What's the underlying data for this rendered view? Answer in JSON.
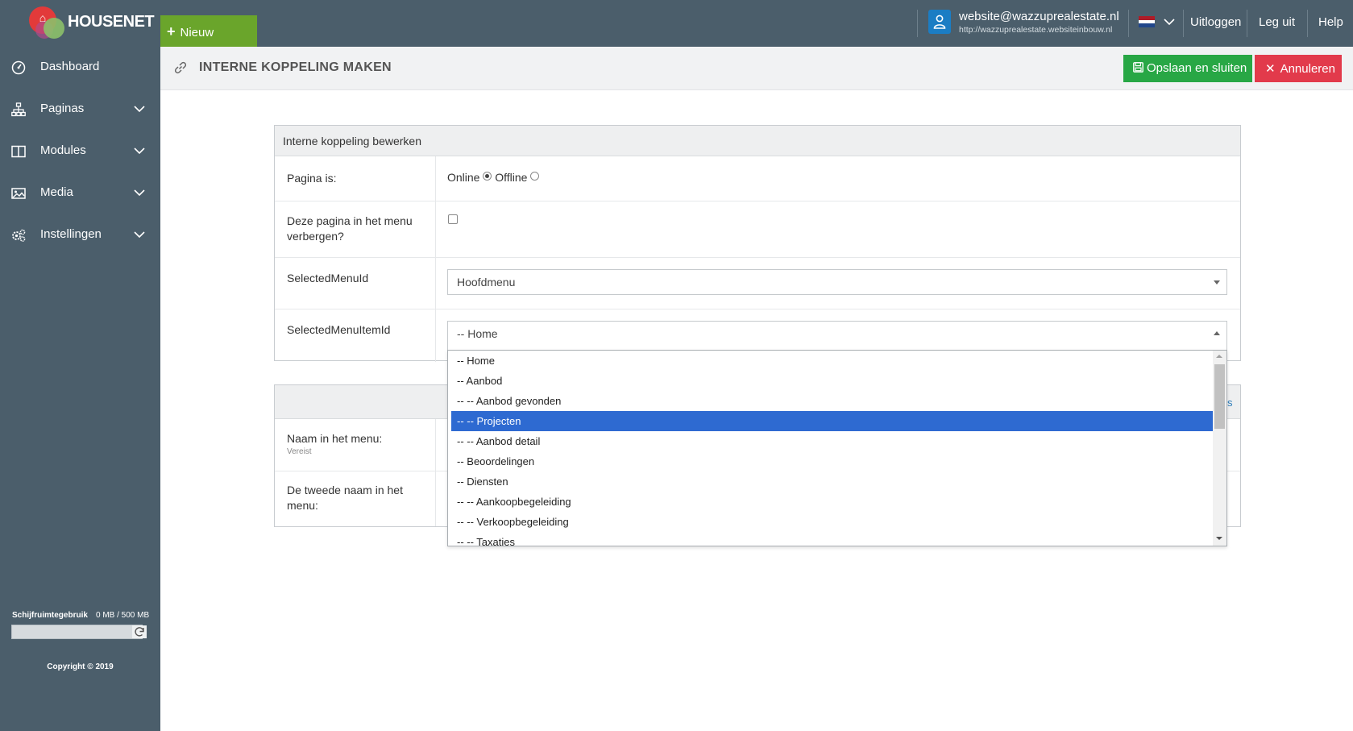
{
  "brand": {
    "name": "HOUSENET"
  },
  "topbar": {
    "new_label": "Nieuw",
    "user_email": "website@wazzuprealestate.nl",
    "user_url": "http://wazzuprealestate.websiteinbouw.nl",
    "logout_label": "Uitloggen",
    "logout2_label": "Leg uit",
    "help_label": "Help"
  },
  "sidebar": {
    "items": [
      {
        "label": "Dashboard",
        "icon": "dashboard-icon"
      },
      {
        "label": "Paginas",
        "icon": "sitemap-icon"
      },
      {
        "label": "Modules",
        "icon": "columns-icon"
      },
      {
        "label": "Media",
        "icon": "image-icon"
      },
      {
        "label": "Instellingen",
        "icon": "cogs-icon"
      }
    ],
    "disk_label": "Schijfruimtegebruik",
    "disk_value": "0 MB / 500 MB",
    "copyright": "Copyright © 2019"
  },
  "header": {
    "title": "INTERNE KOPPELING MAKEN",
    "save_label": "Opslaan en sluiten",
    "cancel_label": "Annuleren"
  },
  "form": {
    "panel_title": "Interne koppeling bewerken",
    "page_is_label": "Pagina is:",
    "online_label": "Online",
    "offline_label": "Offline",
    "status_selected": "Online",
    "hide_menu_label": "Deze pagina in het menu verbergen?",
    "hide_menu_checked": false,
    "menu_id_label": "SelectedMenuId",
    "menu_id_value": "Hoofdmenu",
    "menu_item_label": "SelectedMenuItemId",
    "menu_item_value": "-- Home",
    "name_label": "Naam in het menu:",
    "name_required": "Vereist",
    "second_name_label": "De tweede naam in het menu:",
    "partial_link": "s"
  },
  "dropdown": {
    "options": [
      "-- Home",
      "-- Aanbod",
      "-- -- Aanbod gevonden",
      "-- -- Projecten",
      "-- -- Aanbod detail",
      "-- Beoordelingen",
      "-- Diensten",
      "-- -- Aankoopbegeleiding",
      "-- -- Verkoopbegeleiding",
      "-- -- Taxaties"
    ],
    "highlighted": "-- -- Projecten"
  },
  "colors": {
    "sidebar_bg": "#4b5e6b",
    "new_button": "#6aa52b",
    "save_button": "#28a745",
    "cancel_button": "#e23a4b",
    "selection": "#2e6ad1"
  }
}
